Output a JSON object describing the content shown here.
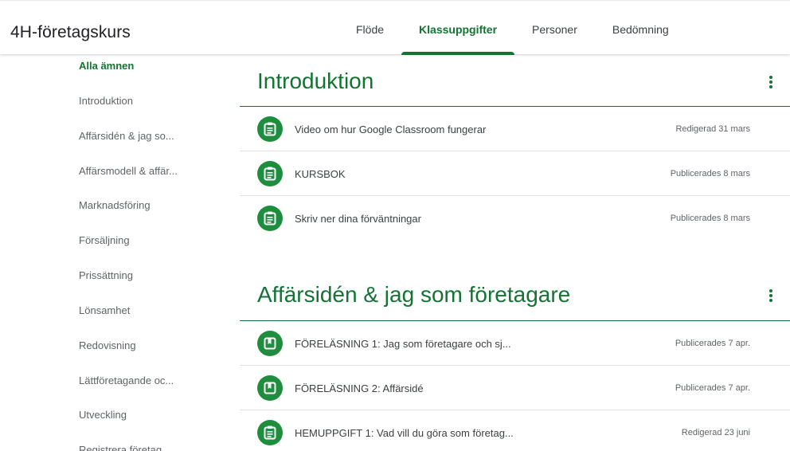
{
  "header": {
    "course_title": "4H-företagskurs",
    "tabs": [
      {
        "label": "Flöde",
        "active": false
      },
      {
        "label": "Klassuppgifter",
        "active": true
      },
      {
        "label": "Personer",
        "active": false
      },
      {
        "label": "Bedömning",
        "active": false
      }
    ]
  },
  "sidebar": {
    "items": [
      {
        "label": "Alla ämnen",
        "active": true
      },
      {
        "label": "Introduktion"
      },
      {
        "label": "Affärsidén & jag so..."
      },
      {
        "label": "Affärsmodell & affär..."
      },
      {
        "label": "Marknadsföring"
      },
      {
        "label": "Försäljning"
      },
      {
        "label": "Prissättning"
      },
      {
        "label": "Lönsamhet"
      },
      {
        "label": "Redovisning"
      },
      {
        "label": "Lättföretagande oc..."
      },
      {
        "label": "Utveckling"
      },
      {
        "label": "Registrera företag"
      }
    ]
  },
  "topics": [
    {
      "title": "Introduktion",
      "items": [
        {
          "title": "Video om hur Google Classroom fungerar",
          "status": "Redigerad 31 mars",
          "icon": "assignment-icon"
        },
        {
          "title": "KURSBOK",
          "status": "Publicerades 8 mars",
          "icon": "assignment-icon"
        },
        {
          "title": "Skriv ner dina förväntningar",
          "status": "Publicerades 8 mars",
          "icon": "assignment-icon"
        }
      ]
    },
    {
      "title": "Affärsidén & jag som företagare",
      "items": [
        {
          "title": "FÖRELÄSNING 1: Jag som företagare och sj...",
          "status": "Publicerades 7 apr.",
          "icon": "material-icon"
        },
        {
          "title": "FÖRELÄSNING 2: Affärsidé",
          "status": "Publicerades 7 apr.",
          "icon": "material-icon"
        },
        {
          "title": "HEMUPPGIFT 1: Vad vill du göra som företag...",
          "status": "Redigerad 23 juni",
          "icon": "assignment-icon"
        }
      ]
    }
  ],
  "colors": {
    "accent": "#137333",
    "icon_bg": "#1e8e3e"
  }
}
